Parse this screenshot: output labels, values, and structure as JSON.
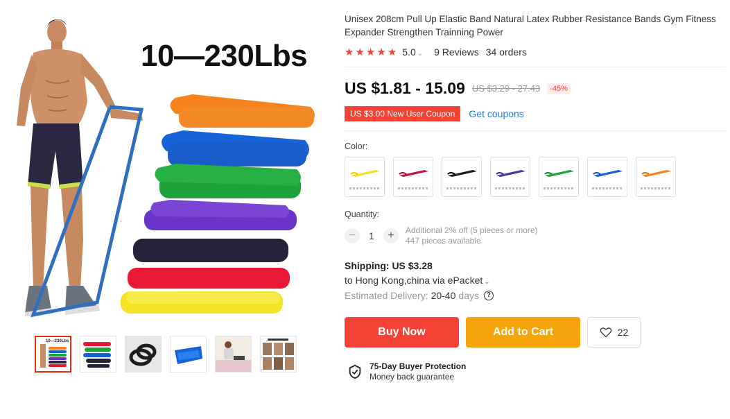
{
  "gallery": {
    "main_image": {
      "label": "10—230Lbs",
      "band_colors": [
        "#f7831e",
        "#1663d8",
        "#1ea33a",
        "#6b34c9",
        "#26233a",
        "#e81836",
        "#f4e324"
      ]
    },
    "thumbnails": [
      {
        "name": "thumb-bands-lineup",
        "active": true,
        "label": "10—230Lbs"
      },
      {
        "name": "thumb-bands-stack",
        "active": false
      },
      {
        "name": "thumb-black-band",
        "active": false
      },
      {
        "name": "thumb-blue-band",
        "active": false
      },
      {
        "name": "thumb-exercise-photo",
        "active": false
      },
      {
        "name": "thumb-exercise-guide",
        "active": false
      }
    ]
  },
  "product": {
    "title": "Unisex 208cm Pull Up Elastic Band Natural Latex Rubber Resistance Bands Gym Fitness Expander Strengthen Trainning Power",
    "rating": "5.0",
    "reviews": "9 Reviews",
    "orders": "34 orders",
    "price": "US $1.81 - 15.09",
    "original_price": "US $3.29 - 27.43",
    "discount": "-45%",
    "coupon": "US $3.00 New User Coupon",
    "get_coupons": "Get coupons",
    "color_label": "Color:",
    "colors": [
      "#f4e324",
      "#c4123e",
      "#1c1c1c",
      "#4b37a8",
      "#1ea33a",
      "#1663d8",
      "#f7831e"
    ],
    "quantity_label": "Quantity:",
    "quantity": "1",
    "quantity_minus": "−",
    "quantity_plus": "+",
    "quantity_offer": "Additional 2% off (5 pieces or more)",
    "quantity_available": "447 pieces available",
    "shipping_label": "Shipping:",
    "shipping_price": "US $3.28",
    "shipping_to": "to Hong Kong,china via ePacket",
    "delivery_label": "Estimated Delivery:",
    "delivery_range": "20-40",
    "delivery_unit": "days",
    "buy_now": "Buy Now",
    "add_to_cart": "Add to Cart",
    "wishlist_count": "22",
    "protection_title": "75-Day Buyer Protection",
    "protection_sub": "Money back guarantee"
  },
  "colors": {
    "accent_red": "#f44336",
    "accent_orange": "#f5a50b",
    "link_blue": "#2a7bd6"
  }
}
